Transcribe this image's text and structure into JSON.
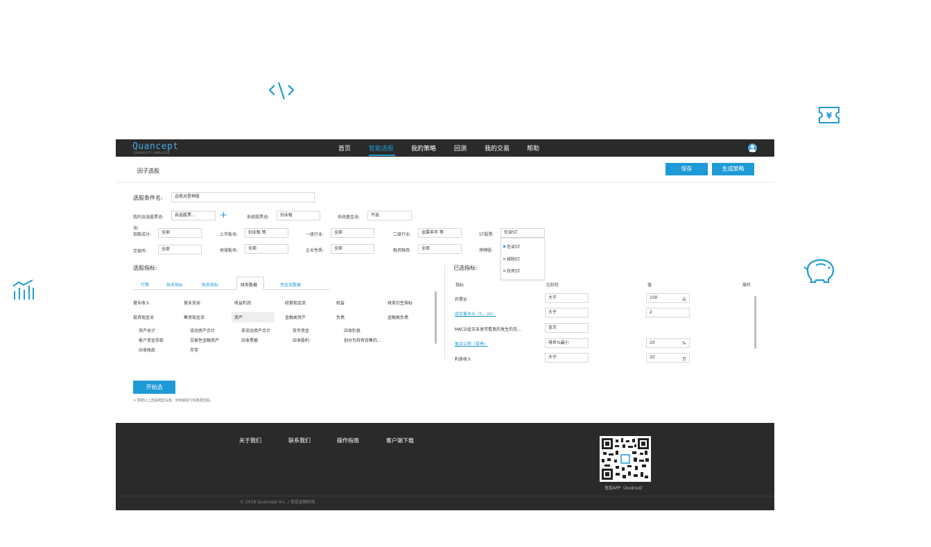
{
  "decorative_icons": [
    "code-icon",
    "ticket-yuan-icon",
    "chart-bars-icon",
    "piggy-bank-icon"
  ],
  "colors": {
    "accent": "#1e9ad6",
    "topbar": "#2a2a2a",
    "footer": "#2a2a2a"
  },
  "brand": {
    "name": "Quancept",
    "tagline": "COMPLEXITY SIMPLIFIED"
  },
  "nav": {
    "items": [
      "首页",
      "智能选股",
      "我的策略",
      "回测",
      "我的交易",
      "帮助"
    ],
    "active": "智能选股"
  },
  "page": {
    "title": "因子选股",
    "save_label": "保存",
    "generate_label": "生成策略"
  },
  "condition": {
    "name_label": "选股条件名:",
    "name_value": "这绝对是神股"
  },
  "filters": {
    "my_pool_label": "我的自选股票池:",
    "my_pool_value": "自选股票...",
    "sys_pool_label": "系统股票池:",
    "sys_pool_value": "创业板",
    "sys_fund_label": "系统基金池:",
    "sys_fund_value": "不选",
    "index_label": "指数成分:",
    "index_value": "全部",
    "listing_label": "上市板块:",
    "listing_value": "创业板 等",
    "industry1_label": "一级行业:",
    "industry1_value": "全部",
    "industry2_label": "二级行业:",
    "industry2_value": "金属非市 等",
    "st_label": "ST股票:",
    "st_value": "包含ST",
    "exchange_label": "交易所:",
    "exchange_value": "全部",
    "region_label": "地域板块:",
    "region_value": "全部",
    "company_label": "企业性质:",
    "company_value": "全部",
    "margin_label": "融资融券:",
    "margin_value": "全部",
    "suspend_label": "停牌股:"
  },
  "st_dropdown": {
    "options": [
      "包含ST",
      "排除ST",
      "仅有ST"
    ],
    "selected": "包含ST"
  },
  "indicators": {
    "section_label": "选股指标:",
    "tabs": [
      "行情",
      "技术指标",
      "财务指标",
      "财务数据",
      "资金流数据"
    ],
    "active_tab": "财务数据",
    "categories_row1": [
      "营业收入",
      "营业支出",
      "收益利润",
      "经营现金流",
      "权益",
      "财务衍生指标"
    ],
    "categories_row2": [
      "投资现金流",
      "筹资现金流",
      "资产",
      "金融类资产",
      "负债",
      "金融类负债"
    ],
    "active_category": "资产",
    "items_row1": [
      "资产总计",
      "流动资产合计",
      "非流动资产合计",
      "货币资金",
      "应收利息"
    ],
    "items_row2": [
      "客户资金存款",
      "交易性金融资产",
      "应收票据",
      "应收股利",
      "划分为持有待售的..."
    ],
    "items_row3": [
      "应收账款",
      "存货"
    ]
  },
  "selected": {
    "section_label": "已选指标:",
    "headers": {
      "indicator": "指标",
      "comparator": "比较符",
      "value": "值",
      "action": "操作"
    },
    "rows": [
      {
        "name": "开票价",
        "comparator": "大于",
        "value": "100",
        "unit": "元",
        "link": false
      },
      {
        "name": "成交量多头（5，20）",
        "comparator": "大于",
        "value": "2",
        "unit": "",
        "link": true
      },
      {
        "name": "MACD金叉未发可看真的发生的见...",
        "comparator": "金叉",
        "value": "",
        "unit": "",
        "link": false
      },
      {
        "name": "盈余公积（单季）",
        "comparator": "排名%最小",
        "value": "20",
        "unit": "%",
        "link": true
      },
      {
        "name": "利息收入",
        "comparator": "大于",
        "value": "20",
        "unit": "万",
        "link": false
      }
    ]
  },
  "run": {
    "button_label": "开始选",
    "note": "✳ 根据以上选股模型设置，使用最新行情数据选股。"
  },
  "footer": {
    "links": [
      "关于我们",
      "联系我们",
      "操作指南",
      "客户端下载"
    ],
    "copyright": "© 2018 Quancept Inc. / 宽投金融科技",
    "qr_caption": "宽投APP（Android）"
  }
}
